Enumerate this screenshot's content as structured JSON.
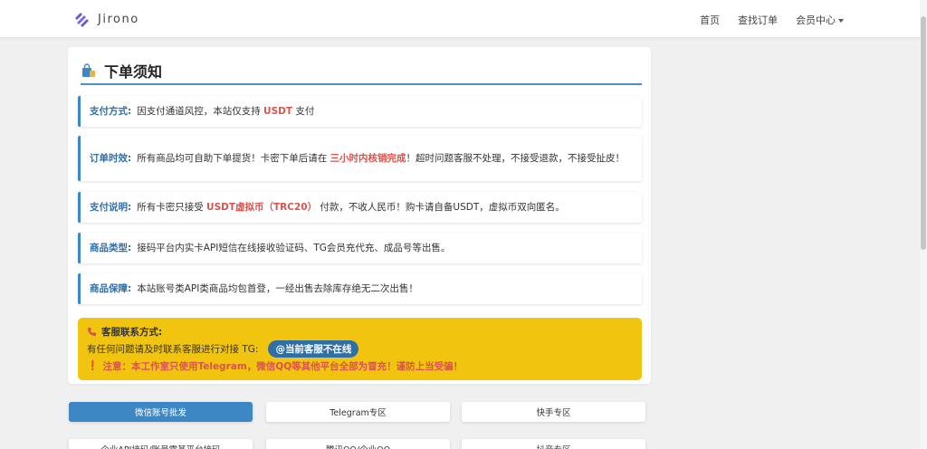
{
  "navbar": {
    "brand": "Jirono",
    "links": [
      "首页",
      "查找订单",
      "会员中心"
    ]
  },
  "card": {
    "title": "下单须知",
    "items": [
      {
        "label": "支付方式:",
        "parts": [
          [
            "因支付通道风控，本站仅支持 ",
            false
          ],
          [
            "USDT",
            true
          ],
          [
            " 支付",
            false
          ]
        ]
      },
      {
        "label": "订单时效:",
        "parts": [
          [
            "所有商品均可自助下单提货！卡密下单后请在 ",
            false
          ],
          [
            "三小时内核销完成",
            true
          ],
          [
            "！超时问题客服不处理，不接受退款，不接受扯皮！",
            false
          ]
        ]
      },
      {
        "label": "支付说明:",
        "parts": [
          [
            "所有卡密只接受 ",
            false
          ],
          [
            "USDT虚拟币（TRC20）",
            true
          ],
          [
            " 付款，不收人民币！购卡请自备USDT，虚拟币双向匿名。",
            false
          ]
        ]
      },
      {
        "label": "商品类型:",
        "parts": [
          [
            "接码平台内实卡API短信在线接收验证码、TG会员充代充、成品号等出售。",
            false
          ]
        ]
      },
      {
        "label": "商品保障:",
        "parts": [
          [
            "本站账号类API类商品均包首登，一经出售去除库存绝无二次出售！",
            false
          ]
        ]
      }
    ],
    "notice": {
      "title": "客服联系方式:",
      "line": "有任何问题请及时联系客服进行对接 TG:",
      "tg_badge": "@当前客服不在线",
      "warning": "注意：本工作室只使用Telegram，微信QQ等其他平台全部为冒充！谨防上当受骗！"
    }
  },
  "categories": [
    {
      "label": "微信账号批发",
      "active": true
    },
    {
      "label": "Telegram专区",
      "active": false
    },
    {
      "label": "快手专区",
      "active": false
    },
    {
      "label": "企业API接码/账号零基平台接码",
      "active": false
    },
    {
      "label": "腾讯QQ/企业QQ",
      "active": false
    },
    {
      "label": "抖音专区",
      "active": false
    }
  ],
  "colors": {
    "accent": "#3d87c4",
    "highlight": "#d9534f",
    "notice_bg": "#f1c40f"
  }
}
